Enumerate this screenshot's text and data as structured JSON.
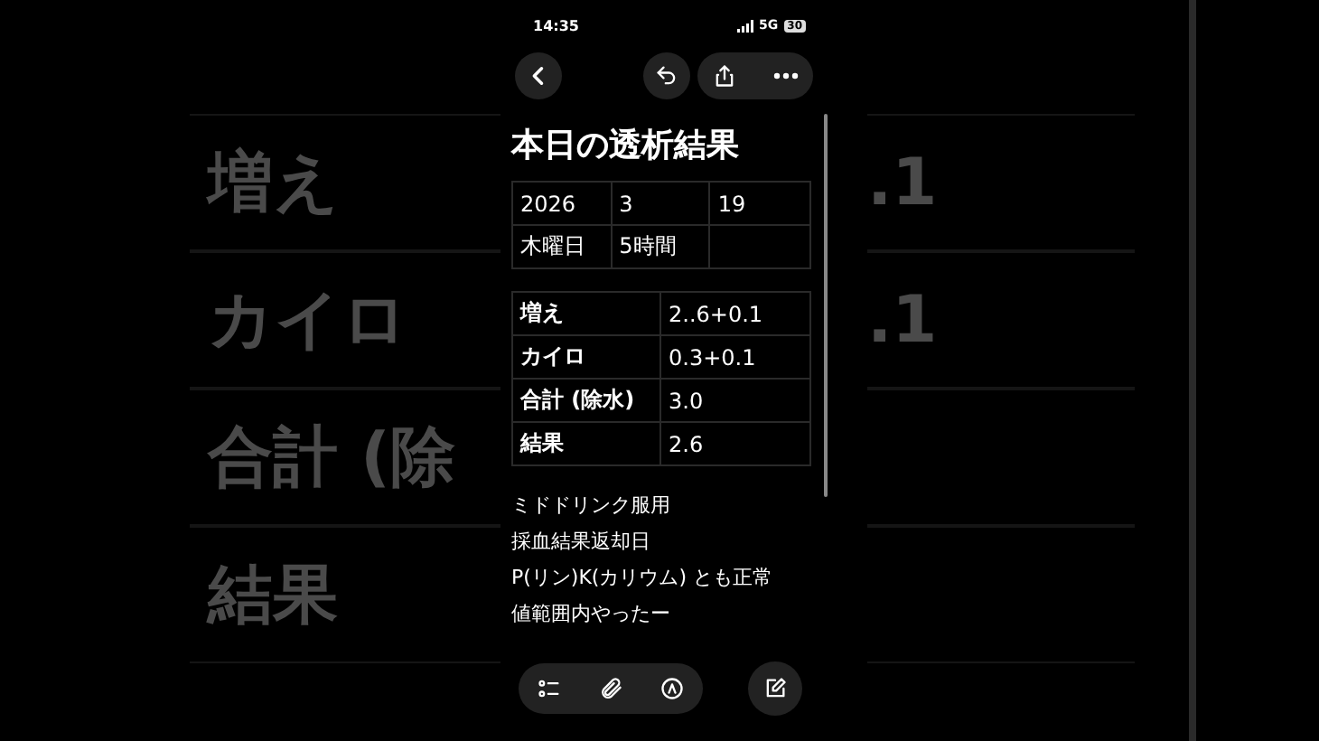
{
  "backdrop": {
    "left_rows": [
      "増え",
      "カイロ",
      "合計 (除",
      "結果"
    ],
    "right_rows": [
      ".1",
      ".1"
    ]
  },
  "status_bar": {
    "time": "14:35",
    "network": "5G",
    "battery": "30"
  },
  "note": {
    "title": "本日の透析結果",
    "date_table": [
      [
        "2026",
        "3",
        "19"
      ],
      [
        "木曜日",
        "5時間"
      ]
    ],
    "result_table": [
      [
        "増え",
        "2..6+0.1"
      ],
      [
        "カイロ",
        "0.3+0.1"
      ],
      [
        "合計 (除水)",
        "3.0"
      ],
      [
        "結果",
        "2.6"
      ]
    ],
    "lines": [
      "ミドドリンク服用",
      "採血結果返却日",
      "P(リン)K(カリウム) とも正常値範囲内やったー"
    ]
  }
}
